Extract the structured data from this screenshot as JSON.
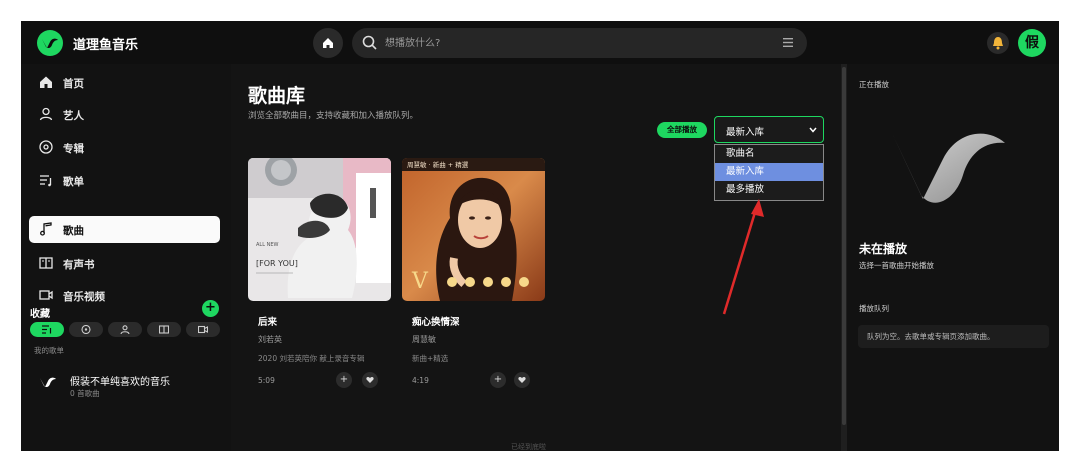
{
  "app": {
    "title": "道理鱼音乐",
    "avatar_text": "假"
  },
  "search": {
    "placeholder": "想播放什么?"
  },
  "sidebar": {
    "items": [
      {
        "label": "首页",
        "icon": "home-icon"
      },
      {
        "label": "艺人",
        "icon": "person-icon"
      },
      {
        "label": "专辑",
        "icon": "disc-icon"
      },
      {
        "label": "歌单",
        "icon": "playlist-icon"
      },
      {
        "label": "歌曲",
        "icon": "music-note-icon",
        "active": true
      },
      {
        "label": "有声书",
        "icon": "book-icon"
      },
      {
        "label": "音乐视频",
        "icon": "video-icon"
      }
    ],
    "favorites_title": "收藏",
    "my_playlists_label": "我的歌单",
    "playlist": {
      "name": "假装不单纯喜欢的音乐",
      "count": "0 首歌曲"
    }
  },
  "main": {
    "title": "歌曲库",
    "subtitle": "浏览全部歌曲目，支持收藏和加入播放队列。",
    "play_all": "全部播放",
    "sort": {
      "selected": "最新入库",
      "options": [
        "歌曲名",
        "最新入库",
        "最多播放"
      ],
      "highlighted": "最新入库"
    },
    "songs": [
      {
        "title": "后来",
        "artist": "刘若英",
        "desc": "2020 刘若英陪你 献上录音专辑",
        "duration": "5:09"
      },
      {
        "title": "痴心换情深",
        "artist": "周慧敏",
        "desc": "新曲+精选",
        "duration": "4:19"
      }
    ],
    "cover_texts": {
      "song1_text": "[FOR YOU]",
      "song2_text": "周慧敏 · 新曲 + 精選"
    },
    "bottom_hint": "已经到底啦"
  },
  "right_panel": {
    "title": "正在播放",
    "not_playing": "未在播放",
    "not_playing_sub": "选择一首歌曲开始播放",
    "queue_title": "播放队列",
    "queue_empty": "队列为空。去歌单或专辑页添加歌曲。"
  },
  "colors": {
    "accent": "#1ed760",
    "highlight": "#6e8fe0",
    "arrow": "#e02a2a"
  }
}
